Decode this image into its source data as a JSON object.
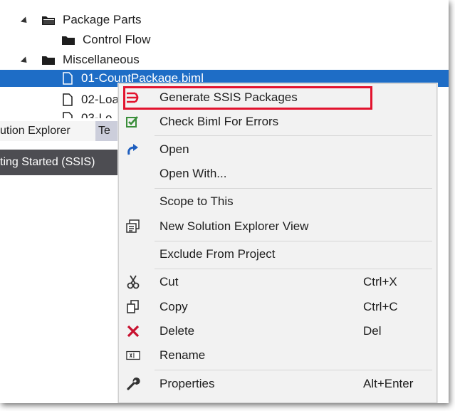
{
  "tree": {
    "items": [
      {
        "label": "Package Parts",
        "expanded": true
      },
      {
        "label": "Control Flow"
      },
      {
        "label": "Miscellaneous",
        "expanded": true
      },
      {
        "label": "01-CountPackage.biml",
        "selected": true
      },
      {
        "label": "02-Loa"
      },
      {
        "label": "03-Lo"
      }
    ]
  },
  "tabs": {
    "active": "ution Explorer",
    "other": "Te"
  },
  "panel_header": "ting Started (SSIS)",
  "context_menu": {
    "items": [
      {
        "label": "Generate SSIS Packages",
        "icon": "generate-ssis-icon",
        "highlighted": true
      },
      {
        "label": "Check Biml For Errors",
        "icon": "check-biml-icon"
      },
      {
        "label": "Open",
        "icon": "open-arrow-icon"
      },
      {
        "label": "Open With..."
      },
      {
        "label": "Scope to This"
      },
      {
        "label": "New Solution Explorer View",
        "icon": "new-view-icon"
      },
      {
        "label": "Exclude From Project"
      },
      {
        "label": "Cut",
        "shortcut": "Ctrl+X",
        "icon": "scissors-icon"
      },
      {
        "label": "Copy",
        "shortcut": "Ctrl+C",
        "icon": "copy-icon"
      },
      {
        "label": "Delete",
        "shortcut": "Del",
        "icon": "delete-x-icon"
      },
      {
        "label": "Rename",
        "icon": "rename-icon"
      },
      {
        "label": "Properties",
        "shortcut": "Alt+Enter",
        "icon": "wrench-icon"
      }
    ]
  },
  "colors": {
    "selection": "#1e6dc6",
    "highlight_border": "#e2132e",
    "delete_icon": "#c8102e",
    "check_icon": "#3a8e3a",
    "open_icon": "#1f5fbf"
  }
}
